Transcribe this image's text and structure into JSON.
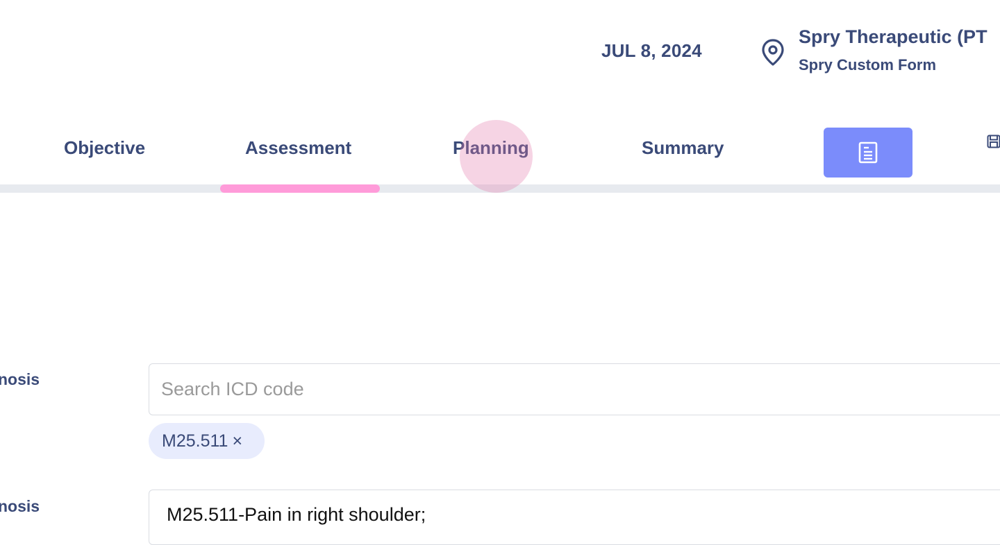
{
  "header": {
    "date": "JUL 8, 2024",
    "clinic_name": "Spry Therapeutic (PT",
    "form_name": "Spry Custom Form",
    "location_icon": "map-pin-icon"
  },
  "tabs": {
    "items": [
      {
        "label": "Objective"
      },
      {
        "label": "Assessment"
      },
      {
        "label": "Planning"
      },
      {
        "label": "Summary"
      }
    ],
    "active": "Assessment",
    "note_button_icon": "document-icon",
    "save_icon": "save-icon"
  },
  "form": {
    "diagnosis_label": "nosis",
    "search": {
      "placeholder": "Search ICD code",
      "value": ""
    },
    "chips": [
      {
        "code": "M25.511",
        "remove": "×"
      }
    ],
    "second_label": "nosis",
    "diagnosis_text": "M25.511-Pain in right shoulder;"
  },
  "colors": {
    "accent_button": "#7b8cfb",
    "tab_indicator": "#ff9bd9",
    "text_primary": "#3a4a78",
    "chip_bg": "#e8ecfd"
  }
}
